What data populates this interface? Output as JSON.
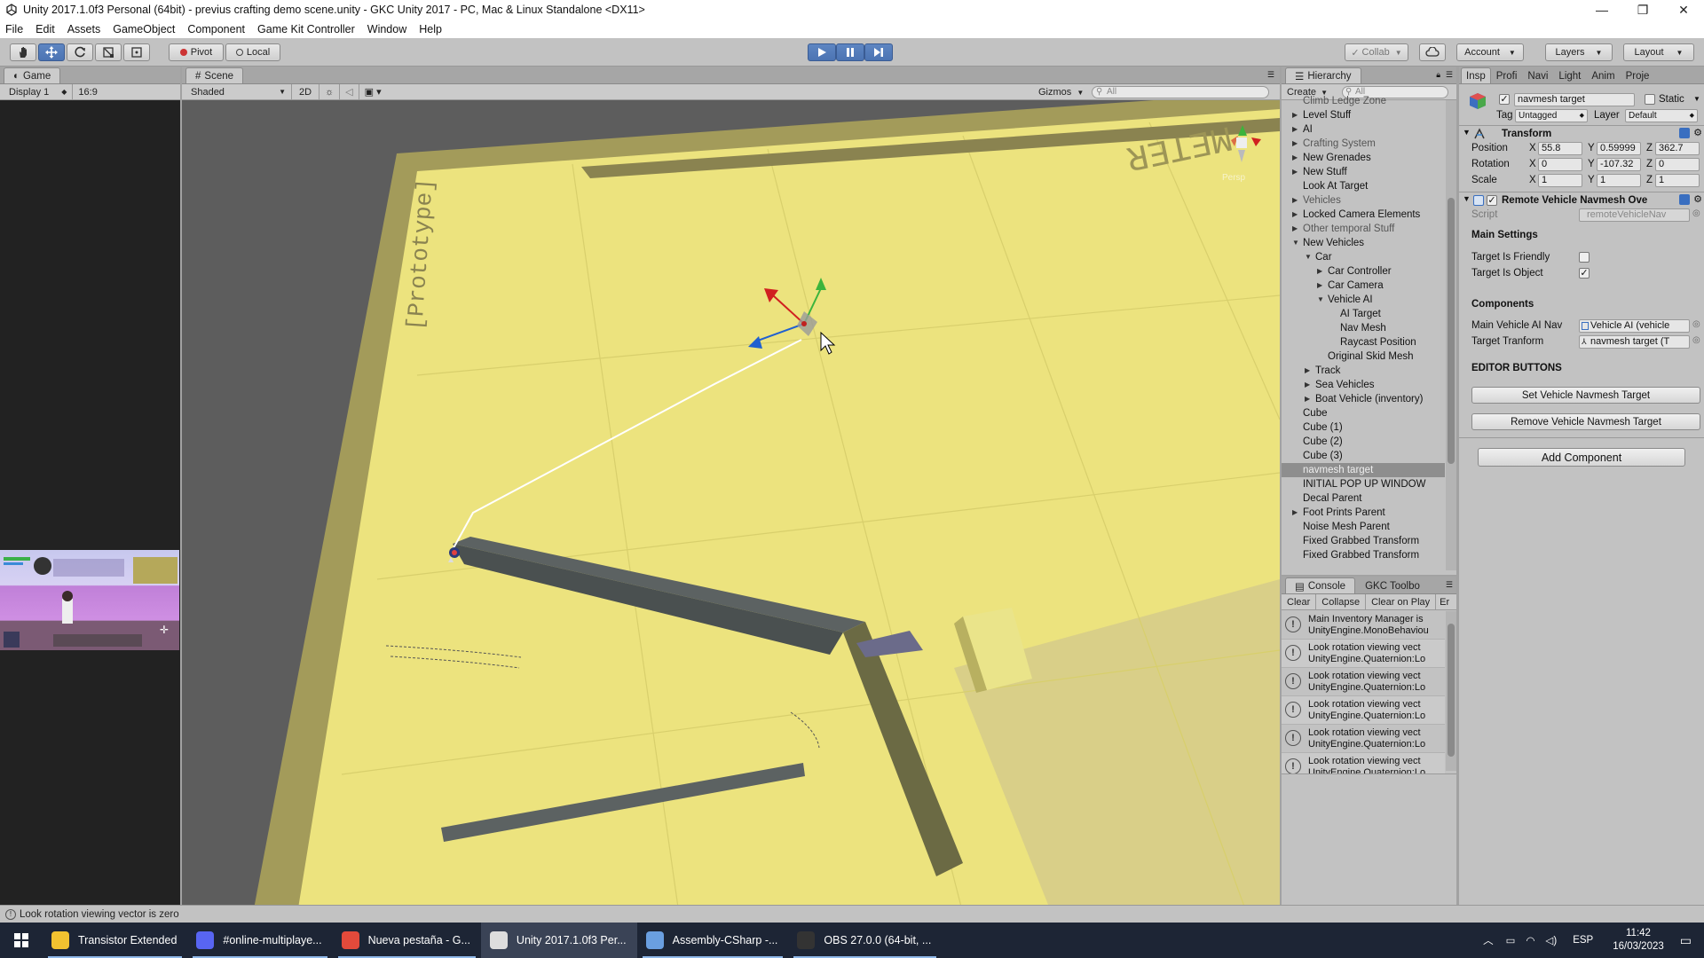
{
  "window": {
    "title": "Unity 2017.1.0f3 Personal (64bit) - previus crafting demo scene.unity - GKC Unity 2017 - PC, Mac & Linux Standalone <DX11>",
    "minimize": "—",
    "maximize": "❐",
    "close": "✕"
  },
  "menu": [
    "File",
    "Edit",
    "Assets",
    "GameObject",
    "Component",
    "Game Kit Controller",
    "Window",
    "Help"
  ],
  "toolbar": {
    "pivot": "Pivot",
    "local": "Local",
    "collab": "Collab",
    "account": "Account",
    "layers": "Layers",
    "layout": "Layout"
  },
  "game": {
    "tab": "Game",
    "display": "Display 1",
    "aspect": "16:9"
  },
  "scene": {
    "tab": "Scene",
    "shading": "Shaded",
    "mode2d": "2D",
    "gizmos": "Gizmos",
    "search_placeholder": "All",
    "prototype_text": "[Prototype]",
    "meter_text": "METER",
    "persp_label": "Persp"
  },
  "hierarchy": {
    "tab": "Hierarchy",
    "create": "Create",
    "search_placeholder": "All",
    "items": [
      {
        "label": "Climb Ledge Zone",
        "indent": 0,
        "arrow": "",
        "state": "dim"
      },
      {
        "label": "Level Stuff",
        "indent": 0,
        "arrow": "▶",
        "state": ""
      },
      {
        "label": "AI",
        "indent": 0,
        "arrow": "▶",
        "state": ""
      },
      {
        "label": "Crafting System",
        "indent": 0,
        "arrow": "▶",
        "state": "dim"
      },
      {
        "label": "New Grenades",
        "indent": 0,
        "arrow": "▶",
        "state": ""
      },
      {
        "label": "New Stuff",
        "indent": 0,
        "arrow": "▶",
        "state": ""
      },
      {
        "label": "Look At Target",
        "indent": 0,
        "arrow": "",
        "state": ""
      },
      {
        "label": "Vehicles",
        "indent": 0,
        "arrow": "▶",
        "state": "dim"
      },
      {
        "label": "Locked Camera Elements",
        "indent": 0,
        "arrow": "▶",
        "state": ""
      },
      {
        "label": "Other temporal Stuff",
        "indent": 0,
        "arrow": "▶",
        "state": "dim"
      },
      {
        "label": "New Vehicles",
        "indent": 0,
        "arrow": "▼",
        "state": ""
      },
      {
        "label": "Car",
        "indent": 1,
        "arrow": "▼",
        "state": ""
      },
      {
        "label": "Car Controller",
        "indent": 2,
        "arrow": "▶",
        "state": ""
      },
      {
        "label": "Car Camera",
        "indent": 2,
        "arrow": "▶",
        "state": ""
      },
      {
        "label": "Vehicle AI",
        "indent": 2,
        "arrow": "▼",
        "state": ""
      },
      {
        "label": "AI Target",
        "indent": 3,
        "arrow": "",
        "state": ""
      },
      {
        "label": "Nav Mesh",
        "indent": 3,
        "arrow": "",
        "state": ""
      },
      {
        "label": "Raycast Position",
        "indent": 3,
        "arrow": "",
        "state": ""
      },
      {
        "label": "Original Skid Mesh",
        "indent": 2,
        "arrow": "",
        "state": ""
      },
      {
        "label": "Track",
        "indent": 1,
        "arrow": "▶",
        "state": ""
      },
      {
        "label": "Sea Vehicles",
        "indent": 1,
        "arrow": "▶",
        "state": ""
      },
      {
        "label": "Boat Vehicle (inventory)",
        "indent": 1,
        "arrow": "▶",
        "state": ""
      },
      {
        "label": "Cube",
        "indent": 0,
        "arrow": "",
        "state": ""
      },
      {
        "label": "Cube (1)",
        "indent": 0,
        "arrow": "",
        "state": ""
      },
      {
        "label": "Cube (2)",
        "indent": 0,
        "arrow": "",
        "state": ""
      },
      {
        "label": "Cube (3)",
        "indent": 0,
        "arrow": "",
        "state": ""
      },
      {
        "label": "navmesh target",
        "indent": 0,
        "arrow": "",
        "state": "selected"
      },
      {
        "label": "INITIAL POP UP WINDOW",
        "indent": 0,
        "arrow": "",
        "state": ""
      },
      {
        "label": "Decal Parent",
        "indent": 0,
        "arrow": "",
        "state": ""
      },
      {
        "label": "Foot Prints Parent",
        "indent": 0,
        "arrow": "▶",
        "state": ""
      },
      {
        "label": "Noise Mesh Parent",
        "indent": 0,
        "arrow": "",
        "state": ""
      },
      {
        "label": "Fixed Grabbed Transform",
        "indent": 0,
        "arrow": "",
        "state": ""
      },
      {
        "label": "Fixed Grabbed Transform",
        "indent": 0,
        "arrow": "",
        "state": ""
      },
      {
        "label": "Fixed Grabbed Transform",
        "indent": 0,
        "arrow": "",
        "state": ""
      }
    ]
  },
  "console": {
    "tab": "Console",
    "tab2": "GKC Toolbo",
    "clear": "Clear",
    "collapse": "Collapse",
    "clear_on_play": "Clear on Play",
    "error_pause": "Er",
    "rows": [
      {
        "line1": "Main Inventory Manager is",
        "line2": "UnityEngine.MonoBehaviou"
      },
      {
        "line1": "Look rotation viewing vect",
        "line2": "UnityEngine.Quaternion:Lo"
      },
      {
        "line1": "Look rotation viewing vect",
        "line2": "UnityEngine.Quaternion:Lo"
      },
      {
        "line1": "Look rotation viewing vect",
        "line2": "UnityEngine.Quaternion:Lo"
      },
      {
        "line1": "Look rotation viewing vect",
        "line2": "UnityEngine.Quaternion:Lo"
      },
      {
        "line1": "Look rotation viewing vect",
        "line2": "UnityEngine.Quaternion:Lo"
      }
    ]
  },
  "inspector": {
    "tabs": [
      "Insp",
      "Profi",
      "Navi",
      "Light",
      "Anim",
      "Proje"
    ],
    "object_name": "navmesh target",
    "static_label": "Static",
    "tag_label": "Tag",
    "tag_value": "Untagged",
    "layer_label": "Layer",
    "layer_value": "Default",
    "transform": {
      "title": "Transform",
      "position_label": "Position",
      "rotation_label": "Rotation",
      "scale_label": "Scale",
      "axis_x": "X",
      "axis_y": "Y",
      "axis_z": "Z",
      "position": {
        "x": "55.8",
        "y": "0.59999",
        "z": "362.7"
      },
      "rotation": {
        "x": "0",
        "y": "-107.32",
        "z": "0"
      },
      "scale": {
        "x": "1",
        "y": "1",
        "z": "1"
      }
    },
    "component": {
      "title": "Remote Vehicle Navmesh Ove",
      "script_label": "Script",
      "script_value": "remoteVehicleNav",
      "main_settings": "Main Settings",
      "friendly_label": "Target Is Friendly",
      "friendly_checked": false,
      "object_label": "Target Is Object",
      "object_checked": true,
      "components_header": "Components",
      "main_ai_label": "Main Vehicle AI Nav",
      "main_ai_value": "Vehicle AI (vehicle",
      "target_tf_label": "Target Tranform",
      "target_tf_value": "navmesh target (T",
      "editor_buttons": "EDITOR BUTTONS",
      "set_btn": "Set Vehicle Navmesh Target",
      "remove_btn": "Remove Vehicle Navmesh Target"
    },
    "add_component": "Add Component"
  },
  "status": "Look rotation viewing vector is zero",
  "taskbar": {
    "items": [
      {
        "label": "Transistor Extended",
        "color": "#f2c230",
        "state": "running"
      },
      {
        "label": "#online-multiplaye...",
        "color": "#5865f2",
        "state": "running"
      },
      {
        "label": "Nueva pestaña - G...",
        "color": "#e24a3b",
        "state": "running"
      },
      {
        "label": "Unity 2017.1.0f3 Per...",
        "color": "#dddddd",
        "state": "active"
      },
      {
        "label": "Assembly-CSharp -...",
        "color": "#6a9fe0",
        "state": "running"
      },
      {
        "label": "OBS 27.0.0 (64-bit, ...",
        "color": "#333333",
        "state": "running"
      }
    ],
    "lang": "ESP",
    "time": "11:42",
    "date": "16/03/2023"
  },
  "colors": {
    "ground": "#ece37e",
    "ground_shadow": "#9a9358",
    "wall": "#5c6262",
    "play_active": "#4c74b3"
  }
}
